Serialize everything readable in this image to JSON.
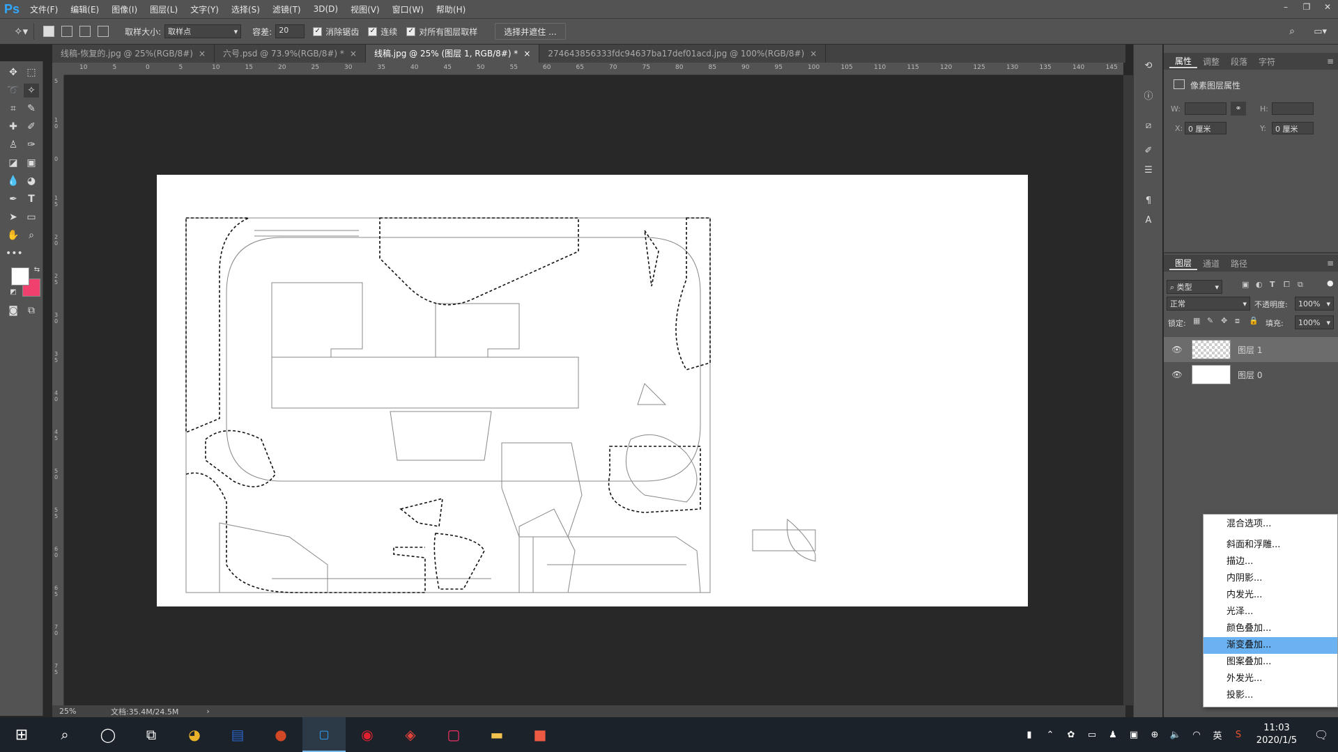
{
  "app": {
    "logo": "Ps"
  },
  "menu": [
    "文件(F)",
    "编辑(E)",
    "图像(I)",
    "图层(L)",
    "文字(Y)",
    "选择(S)",
    "滤镜(T)",
    "3D(D)",
    "视图(V)",
    "窗口(W)",
    "帮助(H)"
  ],
  "options": {
    "sample_size_label": "取样大小:",
    "sample_size_value": "取样点",
    "tolerance_label": "容差:",
    "tolerance_value": "20",
    "antialias_label": "消除锯齿",
    "contiguous_label": "连续",
    "all_layers_label": "对所有图层取样",
    "select_mask_button": "选择并遮住 ..."
  },
  "tabs": [
    {
      "label": "线稿-恢复的.jpg @ 25%(RGB/8#)",
      "close": "×",
      "active": false
    },
    {
      "label": "六号.psd @ 73.9%(RGB/8#) *",
      "close": "×",
      "active": false
    },
    {
      "label": "线稿.jpg @ 25% (图层 1, RGB/8#) *",
      "close": "×",
      "active": true
    },
    {
      "label": "274643856333fdc94637ba17def01acd.jpg @ 100%(RGB/8#)",
      "close": "×",
      "active": false
    }
  ],
  "ruler_top": [
    "10",
    "5",
    "0",
    "5",
    "10",
    "15",
    "20",
    "25",
    "30",
    "35",
    "40",
    "45",
    "50",
    "55",
    "60",
    "65",
    "70",
    "75",
    "80",
    "85",
    "90",
    "95",
    "100",
    "105",
    "110",
    "115",
    "120",
    "125",
    "130",
    "135",
    "140",
    "145"
  ],
  "ruler_left": [
    "5",
    "1 0",
    "0",
    "1 5",
    "2 0",
    "2 5",
    "3 0",
    "3 5",
    "4 0",
    "4 5",
    "5 0",
    "5 5",
    "6 0",
    "6 5",
    "7 0",
    "7 5"
  ],
  "status": {
    "zoom": "25%",
    "doc": "文档:35.4M/24.5M"
  },
  "colors": {
    "foreground": "#ffffff",
    "background": "#f0406e",
    "highlight": "#6ab2f2"
  },
  "properties_panel": {
    "tabs": [
      "属性",
      "调整",
      "段落",
      "字符"
    ],
    "title": "像素图层属性",
    "w_label": "W:",
    "h_label": "H:",
    "x_label": "X:",
    "x_value": "0 厘米",
    "y_label": "Y:",
    "y_value": "0 厘米"
  },
  "layers_panel": {
    "tabs": [
      "图层",
      "通道",
      "路径"
    ],
    "filter": "类型",
    "blend_mode": "正常",
    "opacity_label": "不透明度:",
    "opacity_value": "100%",
    "lock_label": "锁定:",
    "fill_label": "填充:",
    "fill_value": "100%",
    "layers": [
      {
        "name": "图层 1",
        "selected": true
      },
      {
        "name": "图层 0",
        "selected": false
      }
    ]
  },
  "context_menu": [
    {
      "label": "混合选项...",
      "highlighted": false
    },
    {
      "label": "斜面和浮雕...",
      "highlighted": false
    },
    {
      "label": "描边...",
      "highlighted": false
    },
    {
      "label": "内阴影...",
      "highlighted": false
    },
    {
      "label": "内发光...",
      "highlighted": false
    },
    {
      "label": "光泽...",
      "highlighted": false
    },
    {
      "label": "颜色叠加...",
      "highlighted": false
    },
    {
      "label": "渐变叠加...",
      "highlighted": true
    },
    {
      "label": "图案叠加...",
      "highlighted": false
    },
    {
      "label": "外发光...",
      "highlighted": false
    },
    {
      "label": "投影...",
      "highlighted": false
    }
  ],
  "taskbar": {
    "time": "11:03",
    "date": "2020/1/5",
    "ime": "英"
  }
}
